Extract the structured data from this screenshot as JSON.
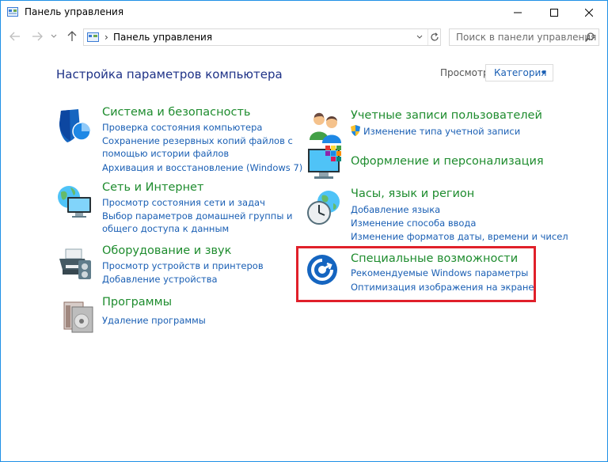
{
  "window": {
    "title": "Панель управления"
  },
  "address": {
    "path": "Панель управления",
    "search_placeholder": "Поиск в панели управления"
  },
  "main": {
    "heading": "Настройка параметров компьютера",
    "view_label": "Просмотр:",
    "view_value": "Категория"
  },
  "categories": {
    "system": {
      "title": "Система и безопасность",
      "links": [
        "Проверка состояния компьютера",
        "Сохранение резервных копий файлов с",
        "помощью истории файлов",
        "Архивация и восстановление (Windows 7)"
      ]
    },
    "network": {
      "title": "Сеть и Интернет",
      "links": [
        "Просмотр состояния сети и задач",
        "Выбор параметров домашней группы и",
        "общего доступа к данным"
      ]
    },
    "hardware": {
      "title": "Оборудование и звук",
      "links": [
        "Просмотр устройств и принтеров",
        "Добавление устройства"
      ]
    },
    "programs": {
      "title": "Программы",
      "links": [
        "Удаление программы"
      ]
    },
    "accounts": {
      "title": "Учетные записи пользователей",
      "links": [
        "Изменение типа учетной записи"
      ]
    },
    "appearance": {
      "title": "Оформление и персонализация"
    },
    "clock": {
      "title": "Часы, язык и регион",
      "links": [
        "Добавление языка",
        "Изменение способа ввода",
        "Изменение форматов даты, времени и чисел"
      ]
    },
    "ease": {
      "title": "Специальные возможности",
      "links": [
        "Рекомендуемые Windows параметры",
        "Оптимизация изображения на экране"
      ]
    }
  },
  "colors": {
    "accent_link": "#1a5fb4",
    "category_title": "#1e8c2e",
    "heading": "#1e3287",
    "highlight": "#e0202a"
  }
}
